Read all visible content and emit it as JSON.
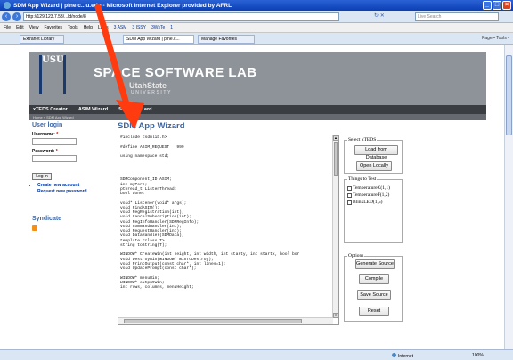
{
  "window": {
    "title": "SDM App Wizard | plne.c...u.edu - Microsoft Internet Explorer provided by AFRL",
    "url": "http://129.123.7.53/...ld/node/8",
    "search_placeholder": "Live Search"
  },
  "menu": {
    "items": [
      "File",
      "Edit",
      "View",
      "Favorites",
      "Tools",
      "Help"
    ],
    "links_label": "Links",
    "links": [
      "3 ASM",
      "3 ISSY",
      "3WsTe",
      "1"
    ]
  },
  "tabs": [
    {
      "label": "Extranet Library"
    },
    {
      "label": "SDM App Wizard | plne.c..."
    },
    {
      "label": "Manage Favorites"
    }
  ],
  "tab_tools": "Page • Tools •",
  "site": {
    "logo_text": "USU",
    "title": "SPACE SOFTWARE LAB",
    "institution": "UtahState",
    "institution_sub": "UNIVERSITY",
    "nav": [
      "xTEDS Creator",
      "ASIM Wizard",
      "SDM",
      "...ard"
    ],
    "breadcrumb": "Home » SDM App Wizard"
  },
  "sidebar": {
    "login_heading": "User login",
    "username_label": "Username:",
    "password_label": "Password:",
    "required_mark": "*",
    "login_button": "Log in",
    "links": [
      "Create new account",
      "Request new password"
    ],
    "syndicate_heading": "Syndicate"
  },
  "main": {
    "title": "SDM App Wizard",
    "code_lines": [
      "#include <sdmlib.h>",
      "",
      "#define ASIM_REQUEST   999",
      "",
      "using namespace std;",
      "",
      "",
      "",
      "",
      "SDMComponent_ID ASIM;",
      "int myPort;",
      "pthread_t ListenThread;",
      "bool done;",
      "",
      "void* Listener(void* args);",
      "void FindASIM();",
      "void RegRegistration(int);",
      "void CancelSubscription(int);",
      "void RegInfoHandler(SDMRegInfo);",
      "void CommandHandler(int);",
      "void RequestHandler(int);",
      "void DataHandler(SDMData);",
      "template <class T>",
      "string toString(T);",
      "",
      "WINDOW* CreateWin(int height, int width, int starty, int startx, bool bor",
      "void DestroyWin(WINDOW* winToDestroy);",
      "void PrintOutput(const char*, int lines=1);",
      "void UpdatePrompt(const char*);",
      "",
      "WINDOW* menuWin;",
      "WINDOW* outputWin;",
      "int rows, columns, menuHeight;"
    ]
  },
  "xteds_group": {
    "legend": "Select xTEDS",
    "load_button": "Load from Database",
    "open_button": "Open Locally"
  },
  "things_group": {
    "legend": "Things to Test",
    "items": [
      "TemperatureC(1,1)",
      "TemperatureF(1,2)",
      "BlinkLED(1,5)"
    ]
  },
  "options_group": {
    "legend": "Options",
    "generate_button": "Generate Source",
    "compile_button": "Compile",
    "save_button": "Save Source",
    "reset_button": "Reset"
  },
  "status": {
    "zone": "Internet",
    "zoom": "100%"
  },
  "colors": {
    "arrow": "#ff3b0f",
    "heading_blue": "#3a66a8",
    "header_gray": "#8e939a",
    "navbar": "#3a3d42"
  }
}
